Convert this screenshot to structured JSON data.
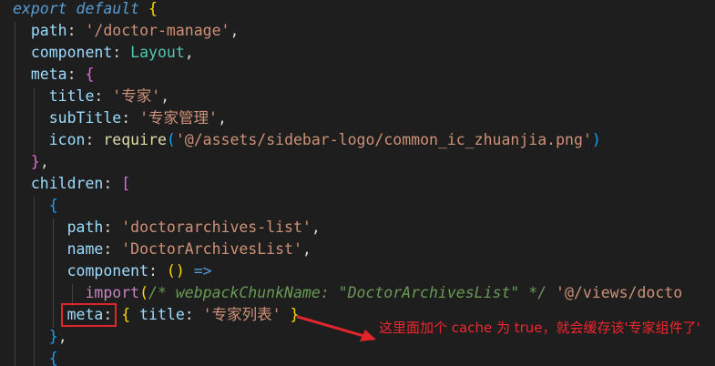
{
  "code": {
    "l1": {
      "kw": "export default",
      "brace": "{"
    },
    "l2": {
      "prop": "path",
      "colon": ": ",
      "str": "'/doctor-manage'",
      "comma": ","
    },
    "l3": {
      "prop": "component",
      "colon": ": ",
      "ident": "Layout",
      "comma": ","
    },
    "l4": {
      "prop": "meta",
      "colon": ": ",
      "brace": "{"
    },
    "l5": {
      "prop": "title",
      "colon": ": ",
      "str": "'专家'",
      "comma": ","
    },
    "l6": {
      "prop": "subTitle",
      "colon": ": ",
      "str": "'专家管理'",
      "comma": ","
    },
    "l7": {
      "prop": "icon",
      "colon": ": ",
      "fn": "require",
      "open": "(",
      "str": "'@/assets/sidebar-logo/common_ic_zhuanjia.png'",
      "close": ")"
    },
    "l8": {
      "brace": "}",
      "comma": ","
    },
    "l9": {
      "prop": "children",
      "colon": ": ",
      "bracket": "["
    },
    "l10": {
      "brace": "{"
    },
    "l11": {
      "prop": "path",
      "colon": ": ",
      "str": "'doctorarchives-list'",
      "comma": ","
    },
    "l12": {
      "prop": "name",
      "colon": ": ",
      "str": "'DoctorArchivesList'",
      "comma": ","
    },
    "l13": {
      "prop": "component",
      "colon": ": ",
      "parens": "()",
      "arrow": " =>"
    },
    "l14": {
      "kw": "import",
      "open": "(",
      "comment": "/* webpackChunkName: \"DoctorArchivesList\" */",
      "str": " '@/views/docto"
    },
    "l15": {
      "prop": "meta",
      "colon": ":",
      "open": " { ",
      "key": "title",
      "colon2": ": ",
      "str": "'专家列表'",
      "close": " }"
    },
    "l16": {
      "brace": "}",
      "comma": ","
    },
    "l17": {
      "brace": "{"
    }
  },
  "annotation": {
    "text": "这里面加个 cache 为 true，就会缓存该'专家组件了'"
  },
  "colors": {
    "background": "#1e1e1e",
    "annotation_red": "#e0252c"
  }
}
